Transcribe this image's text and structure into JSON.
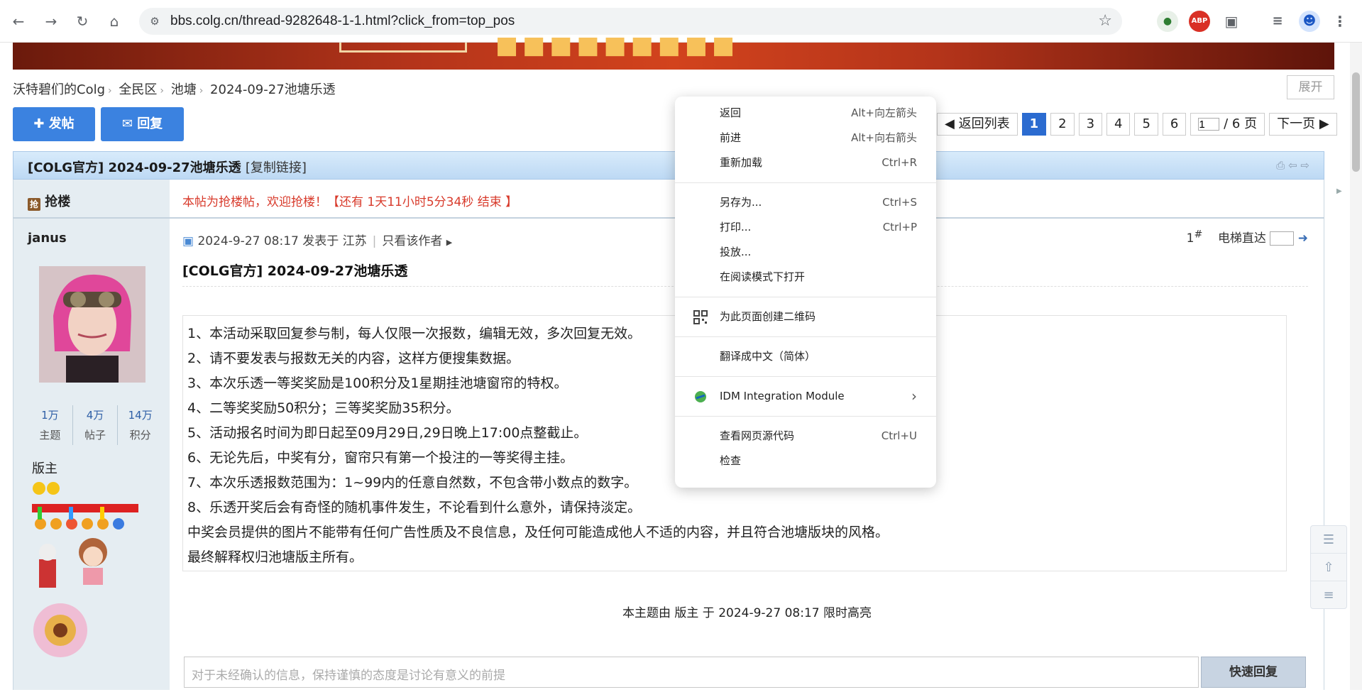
{
  "browser": {
    "url": "bbs.colg.cn/thread-9282648-1-1.html?click_from=top_pos",
    "ext_abp": "ABP"
  },
  "breadcrumb": [
    "沃特碧们的Colg",
    "全民区",
    "池塘",
    "2024-09-27池塘乐透"
  ],
  "expand_label": "展开",
  "buttons": {
    "post": "发帖",
    "reply": "回复"
  },
  "pager": {
    "back": "返回列表",
    "pages": [
      "1",
      "2",
      "3",
      "4",
      "5",
      "6"
    ],
    "current_input": "1",
    "total": "/ 6 页",
    "next": "下一页"
  },
  "thread": {
    "title": "[COLG官方] 2024-09-27池塘乐透",
    "copy_link": "[复制链接]"
  },
  "sidebar": {
    "grab_label": "抢楼",
    "grab_icon_char": "抢",
    "username": "janus",
    "stats": [
      {
        "value": "1万",
        "key": "主题"
      },
      {
        "value": "4万",
        "key": "帖子"
      },
      {
        "value": "14万",
        "key": "积分"
      }
    ],
    "role": "版主"
  },
  "post": {
    "grab_tip": "本帖为抢楼帖，欢迎抢楼！【还有 1天11小时5分34秒 结束 】",
    "date": "2024-9-27 08:17 发表于 江苏",
    "only_author": "只看该作者",
    "floor_num": "1",
    "floor_sup": "#",
    "elevator": "电梯直达",
    "title": "[COLG官方] 2024-09-27池塘乐透",
    "rules": [
      "1、本活动采取回复参与制，每人仅限一次报数，编辑无效，多次回复无效。",
      "2、请不要发表与报数无关的内容，这样方便搜集数据。",
      "3、本次乐透一等奖奖励是100积分及1星期挂池塘窗帘的特权。",
      "4、二等奖奖励50积分；三等奖奖励35积分。",
      "5、活动报名时间为即日起至09月29日,29日晚上17:00点整截止。",
      "6、无论先后，中奖有分，窗帘只有第一个投注的一等奖得主挂。",
      "7、本次乐透报数范围为：1~99内的任意自然数，不包含带小数点的数字。",
      "8、乐透开奖后会有奇怪的随机事件发生，不论看到什么意外，请保持淡定。",
      "中奖会员提供的图片不能带有任何广告性质及不良信息，及任何可能造成他人不适的内容，并且符合池塘版块的风格。",
      "最终解释权归池塘版主所有。"
    ],
    "highlight_note": "本主题由 版主 于 2024-9-27 08:17 限时高亮",
    "reply_placeholder": "对于未经确认的信息，保持谨慎的态度是讨论有意义的前提",
    "quick_reply": "快速回复"
  },
  "context_menu": {
    "groups": [
      [
        {
          "label": "返回",
          "shortcut": "Alt+向左箭头"
        },
        {
          "label": "前进",
          "shortcut": "Alt+向右箭头"
        },
        {
          "label": "重新加载",
          "shortcut": "Ctrl+R"
        }
      ],
      [
        {
          "label": "另存为...",
          "shortcut": "Ctrl+S"
        },
        {
          "label": "打印...",
          "shortcut": "Ctrl+P"
        },
        {
          "label": "投放...",
          "shortcut": ""
        },
        {
          "label": "在阅读模式下打开",
          "shortcut": ""
        }
      ],
      [
        {
          "label": "为此页面创建二维码",
          "shortcut": ""
        }
      ],
      [
        {
          "label": "翻译成中文（简体）",
          "shortcut": ""
        }
      ],
      [
        {
          "label": "IDM Integration Module",
          "shortcut": "›"
        }
      ],
      [
        {
          "label": "查看网页源代码",
          "shortcut": "Ctrl+U"
        },
        {
          "label": "检查",
          "shortcut": ""
        }
      ]
    ]
  }
}
